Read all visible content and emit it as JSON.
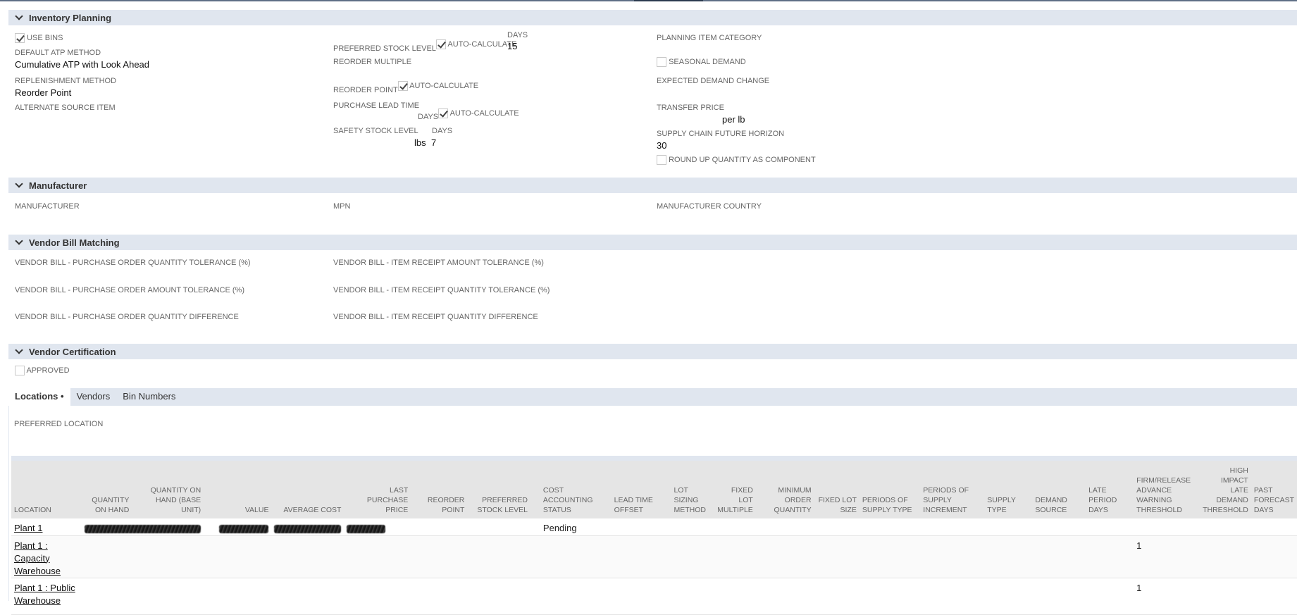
{
  "sections": {
    "inventory": "Inventory Planning",
    "manufacturer": "Manufacturer",
    "vbm": "Vendor Bill Matching",
    "vcert": "Vendor Certification"
  },
  "inventory": {
    "use_bins": "USE BINS",
    "use_bins_checked": true,
    "default_atp_label": "DEFAULT ATP METHOD",
    "default_atp_value": "Cumulative ATP with Look Ahead",
    "replenishment_label": "REPLENISHMENT METHOD",
    "replenishment_value": "Reorder Point",
    "alternate_label": "ALTERNATE SOURCE ITEM",
    "preferred_stock_label": "PREFERRED STOCK LEVEL",
    "auto_calc": "AUTO-CALCULATE",
    "days": "DAYS",
    "preferred_days_value": "15",
    "reorder_multiple_label": "REORDER MULTIPLE",
    "reorder_point_label": "REORDER POINT",
    "purchase_lead_label": "PURCHASE LEAD TIME",
    "safety_stock_label": "SAFETY STOCK LEVEL",
    "safety_unit": "lbs",
    "safety_days_value": "7",
    "planning_category_label": "PLANNING ITEM CATEGORY",
    "seasonal_label": "SEASONAL DEMAND",
    "expected_demand_label": "EXPECTED DEMAND CHANGE",
    "transfer_price_label": "TRANSFER PRICE",
    "transfer_unit": "per lb",
    "horizon_label": "SUPPLY CHAIN FUTURE HORIZON",
    "horizon_value": "30",
    "round_up_label": "ROUND UP QUANTITY AS COMPONENT"
  },
  "manufacturer": {
    "manufacturer": "MANUFACTURER",
    "mpn": "MPN",
    "country": "MANUFACTURER COUNTRY"
  },
  "vbm": {
    "po_qty_tol": "VENDOR BILL - PURCHASE ORDER QUANTITY TOLERANCE (%)",
    "po_amt_tol": "VENDOR BILL - PURCHASE ORDER AMOUNT TOLERANCE (%)",
    "po_qty_diff": "VENDOR BILL - PURCHASE ORDER QUANTITY DIFFERENCE",
    "ir_amt_tol": "VENDOR BILL - ITEM RECEIPT AMOUNT TOLERANCE (%)",
    "ir_qty_tol": "VENDOR BILL - ITEM RECEIPT QUANTITY TOLERANCE (%)",
    "ir_qty_diff": "VENDOR BILL - ITEM RECEIPT QUANTITY DIFFERENCE"
  },
  "vcert": {
    "approved": "APPROVED"
  },
  "tabs": [
    {
      "label": "Locations •"
    },
    {
      "label": "Vendors"
    },
    {
      "label": "Bin Numbers"
    }
  ],
  "preferred_location_label": "PREFERRED LOCATION",
  "table": {
    "headers": [
      "LOCATION",
      "QUANTITY ON HAND",
      "QUANTITY ON HAND (BASE UNIT)",
      "VALUE",
      "AVERAGE COST",
      "LAST PURCHASE PRICE",
      "REORDER POINT",
      "PREFERRED STOCK LEVEL",
      "COST ACCOUNTING STATUS",
      "LEAD TIME OFFSET",
      "LOT SIZING METHOD",
      "FIXED LOT MULTIPLE",
      "MINIMUM ORDER QUANTITY",
      "FIXED LOT SIZE",
      "PERIODS OF SUPPLY TYPE",
      "PERIODS OF SUPPLY INCREMENT",
      "SUPPLY TYPE",
      "DEMAND SOURCE",
      "LATE PERIOD DAYS",
      "FIRM/RELEASE ADVANCE WARNING THRESHOLD",
      "HIGH IMPACT LATE DEMAND THRESHOLD",
      "PAST FORECAST DAYS"
    ],
    "rows": [
      {
        "location": "Plant 1",
        "status": "Pending",
        "firm": ""
      },
      {
        "location": "Plant 1 : Capacity Warehouse",
        "status": "",
        "firm": "1"
      },
      {
        "location": "Plant 1 : Public Warehouse",
        "status": "",
        "firm": "1"
      }
    ]
  }
}
